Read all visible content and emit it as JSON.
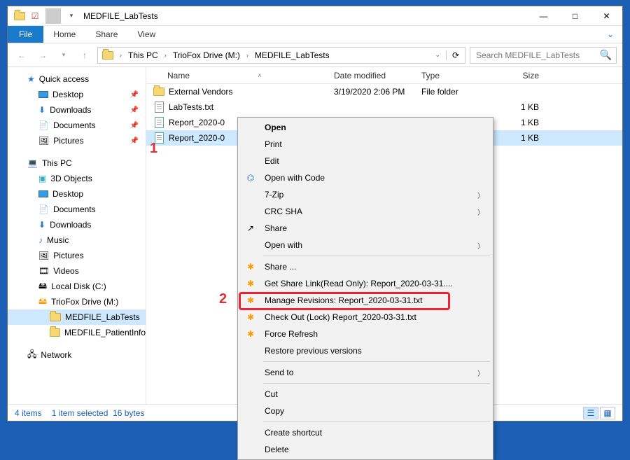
{
  "titlebar": {
    "title": "MEDFILE_LabTests"
  },
  "win": {
    "min": "—",
    "max": "□",
    "close": "✕"
  },
  "ribbon": {
    "file": "File",
    "home": "Home",
    "share": "Share",
    "view": "View"
  },
  "breadcrumb": [
    "This PC",
    "TrioFox Drive (M:)",
    "MEDFILE_LabTests"
  ],
  "search": {
    "placeholder": "Search MEDFILE_LabTests"
  },
  "tree": {
    "quick": "Quick access",
    "quick_items": [
      "Desktop",
      "Downloads",
      "Documents",
      "Pictures"
    ],
    "thispc": "This PC",
    "pc_items": [
      "3D Objects",
      "Desktop",
      "Documents",
      "Downloads",
      "Music",
      "Pictures",
      "Videos",
      "Local Disk (C:)",
      "TrioFox Drive (M:)"
    ],
    "triofox_children": [
      "MEDFILE_LabTests",
      "MEDFILE_PatientInfo"
    ],
    "network": "Network"
  },
  "columns": {
    "name": "Name",
    "date": "Date modified",
    "type": "Type",
    "size": "Size"
  },
  "files": [
    {
      "name": "External Vendors",
      "date": "3/19/2020 2:06 PM",
      "type": "File folder",
      "size": "",
      "kind": "folder",
      "selected": false
    },
    {
      "name": "LabTests.txt",
      "date": "",
      "type": "",
      "size": "1 KB",
      "kind": "txt",
      "selected": false
    },
    {
      "name": "Report_2020-0",
      "date": "",
      "type": "",
      "size": "1 KB",
      "kind": "txt",
      "selected": false
    },
    {
      "name": "Report_2020-0",
      "date": "",
      "type": "",
      "size": "1 KB",
      "kind": "txt",
      "selected": true
    }
  ],
  "ctx": {
    "open": "Open",
    "print": "Print",
    "edit": "Edit",
    "open_code": "Open with Code",
    "sevenzip": "7-Zip",
    "crcsha": "CRC SHA",
    "share": "Share",
    "open_with": "Open with",
    "share2": "Share ...",
    "get_link": "Get Share Link(Read Only): Report_2020-03-31....",
    "manage_rev": "Manage Revisions: Report_2020-03-31.txt",
    "checkout": "Check Out (Lock) Report_2020-03-31.txt",
    "force_refresh": "Force Refresh",
    "restore_prev": "Restore previous versions",
    "send_to": "Send to",
    "cut": "Cut",
    "copy": "Copy",
    "create_shortcut": "Create shortcut",
    "delete": "Delete"
  },
  "status": {
    "items": "4 items",
    "selected": "1 item selected",
    "bytes": "16 bytes"
  },
  "callouts": {
    "one": "1",
    "two": "2"
  }
}
